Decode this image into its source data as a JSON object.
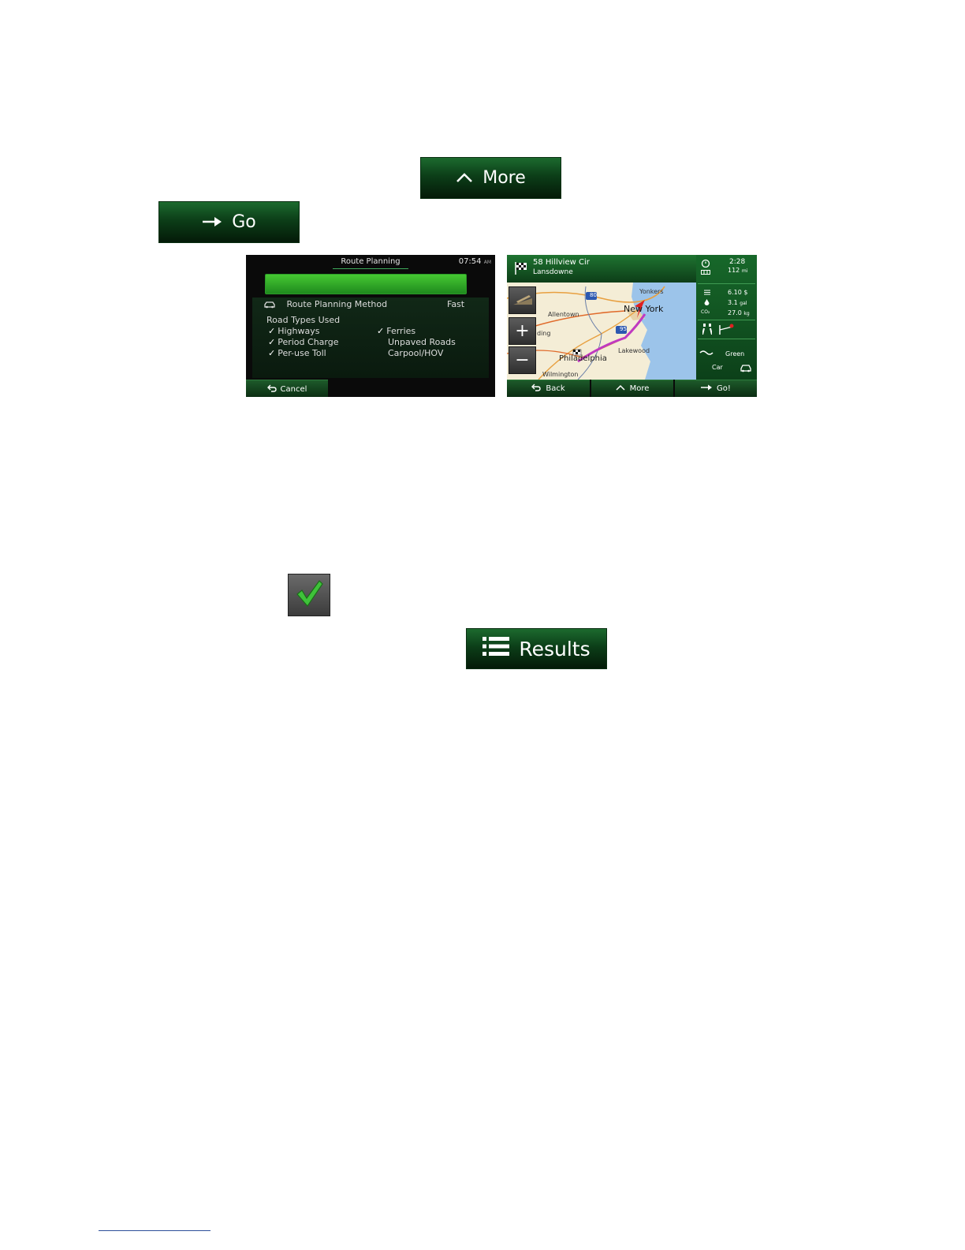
{
  "buttons": {
    "more_label": "More",
    "go_label": "Go",
    "results_label": "Results"
  },
  "route_planning": {
    "title": "Route Planning",
    "clock": "07:54",
    "clock_suffix": "AM",
    "method_label": "Route Planning Method",
    "method_value": "Fast",
    "road_types_heading": "Road Types Used",
    "road_types": {
      "highways": "Highways",
      "period_charge": "Period Charge",
      "per_use_toll": "Per-use Toll",
      "ferries": "Ferries",
      "unpaved_roads": "Unpaved Roads",
      "carpool_hov": "Carpool/HOV"
    },
    "cancel_label": "Cancel",
    "progress": 1.0
  },
  "route_map": {
    "address_line1": "58 Hillview Cir",
    "address_line2": "Lansdowne",
    "time": "2:28",
    "distance": "112",
    "distance_unit": "mi",
    "cost": "6.10 $",
    "fuel": "3.1",
    "fuel_unit": "gal",
    "co2_label": "CO₂",
    "co2": "27.0",
    "co2_unit": "kg",
    "vehicle_mode": "Green",
    "vehicle_type": "Car",
    "zoom_in": "+",
    "zoom_out": "−",
    "back_label": "Back",
    "more_label": "More",
    "go_label": "Go!",
    "map_labels": {
      "yonkers": "Yonkers",
      "new_york": "New York",
      "allentown": "Allentown",
      "reading": "ding",
      "lakewood": "Lakewood",
      "philadelphia": "Philadelphia",
      "wilmington": "Wilmington",
      "i80": "80",
      "i95": "95"
    }
  },
  "colors": {
    "button_green": "#0c3e18",
    "accent_green": "#46c832",
    "route_red": "#e02020",
    "water_blue": "#9cc4ea"
  }
}
